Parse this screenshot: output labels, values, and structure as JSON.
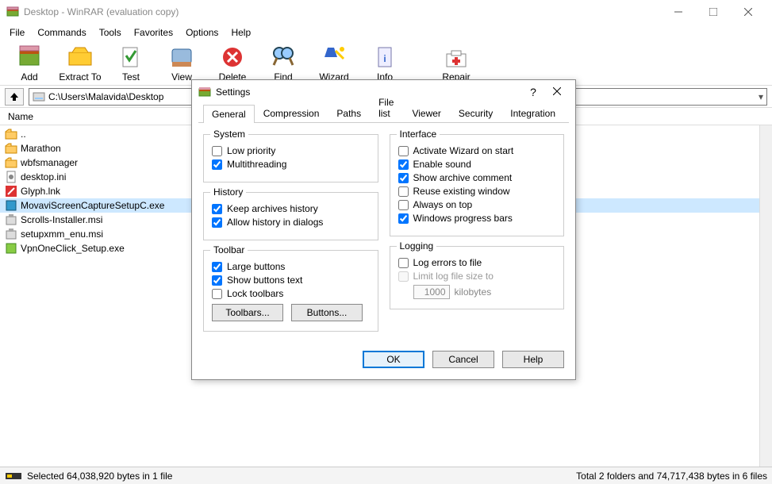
{
  "window": {
    "title": "Desktop - WinRAR (evaluation copy)"
  },
  "menu": [
    "File",
    "Commands",
    "Tools",
    "Favorites",
    "Options",
    "Help"
  ],
  "toolbar": [
    {
      "label": "Add"
    },
    {
      "label": "Extract To"
    },
    {
      "label": "Test"
    },
    {
      "label": "View"
    },
    {
      "label": "Delete"
    },
    {
      "label": "Find"
    },
    {
      "label": "Wizard"
    },
    {
      "label": "Info"
    },
    {
      "label": "Repair"
    }
  ],
  "address": {
    "path": "C:\\Users\\Malavida\\Desktop"
  },
  "list": {
    "header": "Name",
    "items": [
      {
        "name": "..",
        "icon": "folder-up"
      },
      {
        "name": "Marathon",
        "icon": "folder"
      },
      {
        "name": "wbfsmanager",
        "icon": "folder"
      },
      {
        "name": "desktop.ini",
        "icon": "ini"
      },
      {
        "name": "Glyph.lnk",
        "icon": "lnk"
      },
      {
        "name": "MovaviScreenCaptureSetupC.exe",
        "icon": "exe",
        "selected": true
      },
      {
        "name": "Scrolls-Installer.msi",
        "icon": "msi"
      },
      {
        "name": "setupxmm_enu.msi",
        "icon": "msi"
      },
      {
        "name": "VpnOneClick_Setup.exe",
        "icon": "exe"
      }
    ]
  },
  "status": {
    "left": "Selected 64,038,920 bytes in 1 file",
    "right": "Total 2 folders and 74,717,438 bytes in 6 files"
  },
  "dialog": {
    "title": "Settings",
    "tabs": [
      "General",
      "Compression",
      "Paths",
      "File list",
      "Viewer",
      "Security",
      "Integration"
    ],
    "activeTab": 0,
    "groups": {
      "system": {
        "label": "System",
        "items": [
          {
            "label": "Low priority",
            "checked": false
          },
          {
            "label": "Multithreading",
            "checked": true
          }
        ]
      },
      "history": {
        "label": "History",
        "items": [
          {
            "label": "Keep archives history",
            "checked": true
          },
          {
            "label": "Allow history in dialogs",
            "checked": true
          }
        ]
      },
      "toolbar": {
        "label": "Toolbar",
        "items": [
          {
            "label": "Large buttons",
            "checked": true
          },
          {
            "label": "Show buttons text",
            "checked": true
          },
          {
            "label": "Lock toolbars",
            "checked": false
          }
        ],
        "btn1": "Toolbars...",
        "btn2": "Buttons..."
      },
      "interface": {
        "label": "Interface",
        "items": [
          {
            "label": "Activate Wizard on start",
            "checked": false
          },
          {
            "label": "Enable sound",
            "checked": true
          },
          {
            "label": "Show archive comment",
            "checked": true
          },
          {
            "label": "Reuse existing window",
            "checked": false
          },
          {
            "label": "Always on top",
            "checked": false
          },
          {
            "label": "Windows progress bars",
            "checked": true
          }
        ]
      },
      "logging": {
        "label": "Logging",
        "items": [
          {
            "label": "Log errors to file",
            "checked": false
          },
          {
            "label": "Limit log file size to",
            "checked": false,
            "disabled": true
          }
        ],
        "sizeValue": "1000",
        "sizeUnit": "kilobytes"
      }
    },
    "footer": {
      "ok": "OK",
      "cancel": "Cancel",
      "help": "Help"
    }
  }
}
